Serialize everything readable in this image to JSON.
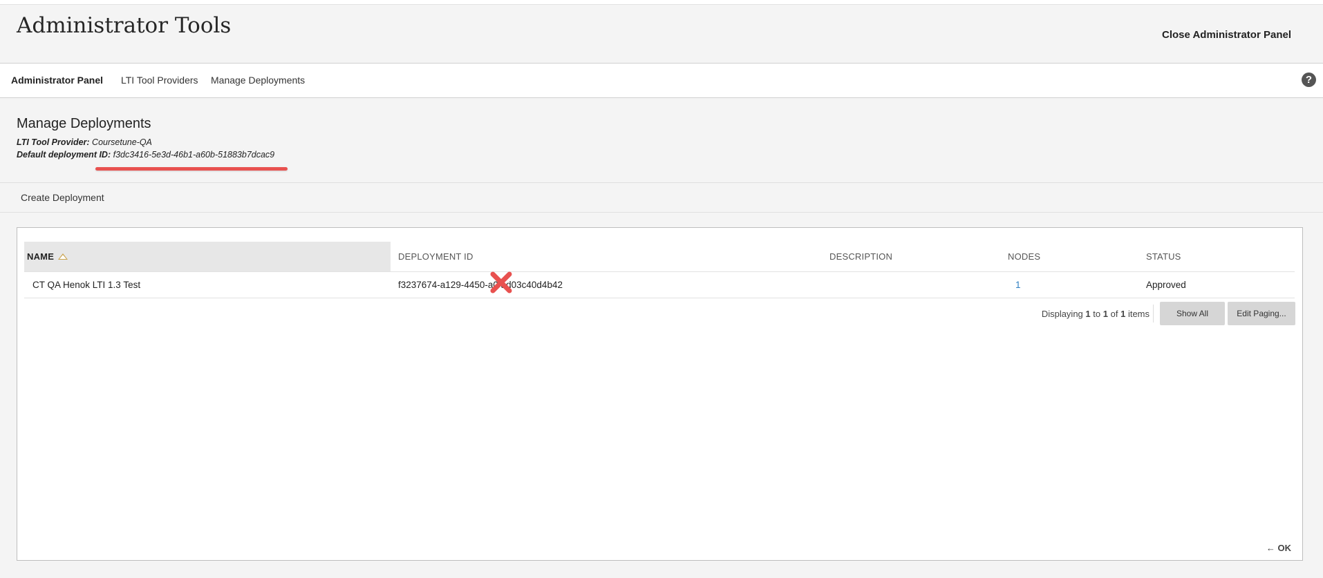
{
  "header": {
    "title": "Administrator Tools",
    "close_label": "Close Administrator Panel"
  },
  "nav": {
    "items": [
      {
        "label": "Administrator Panel"
      },
      {
        "label": "LTI Tool Providers"
      },
      {
        "label": "Manage Deployments"
      }
    ],
    "help_label": "?"
  },
  "page": {
    "title": "Manage Deployments",
    "provider_label": "LTI Tool Provider:",
    "provider_value": "Coursetune-QA",
    "deployment_label": "Default deployment ID:",
    "deployment_value": "f3dc3416-5e3d-46b1-a60b-51883b7dcac9"
  },
  "actions": {
    "create_label": "Create Deployment"
  },
  "table": {
    "columns": [
      "NAME",
      "DEPLOYMENT ID",
      "DESCRIPTION",
      "NODES",
      "STATUS"
    ],
    "rows": [
      {
        "name": "CT QA Henok LTI 1.3 Test",
        "deployment_id": "f3237674-a129-4450-a0[hidden]ad03c40d4b42",
        "deployment_id_display": "f3237674-a129-4450-a0  ad03c40d4b42",
        "description": "",
        "nodes": "1",
        "status": "Approved"
      }
    ]
  },
  "paging": {
    "prefix": "Displaying",
    "from": "1",
    "to_word": "to",
    "to": "1",
    "of_word": "of",
    "total": "1",
    "suffix": "items",
    "show_all_label": "Show All",
    "edit_paging_label": "Edit Paging..."
  },
  "footer": {
    "ok_label": "OK"
  },
  "colors": {
    "accent_red": "#e8514f",
    "link_blue": "#2f7fc1",
    "sort_gold": "#c9a24a"
  }
}
